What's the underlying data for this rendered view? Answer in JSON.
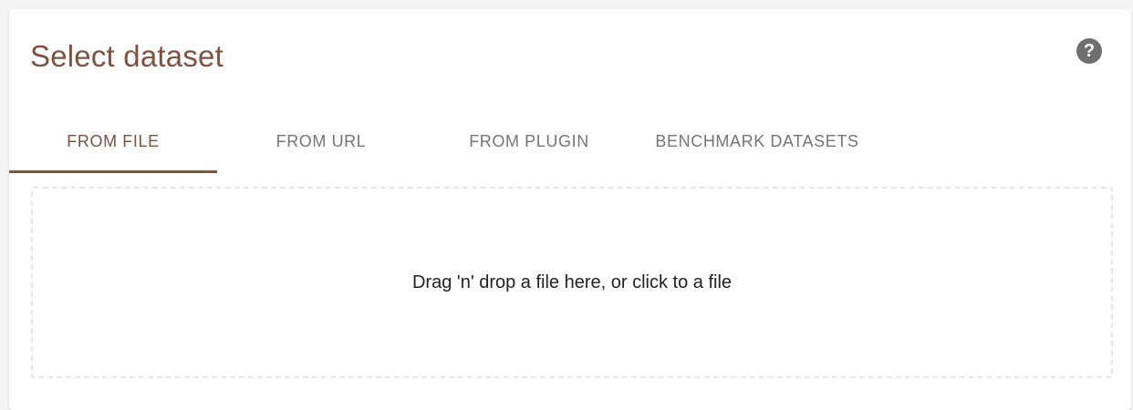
{
  "title": "Select dataset",
  "help_icon": {
    "icon": "help-circle-icon",
    "glyph": "?"
  },
  "tabs": [
    {
      "label": "FROM FILE",
      "active": true
    },
    {
      "label": "FROM URL",
      "active": false
    },
    {
      "label": "FROM PLUGIN",
      "active": false
    },
    {
      "label": "BENCHMARK DATASETS",
      "active": false
    }
  ],
  "dropzone": {
    "text": "Drag 'n' drop a file here, or click to a file"
  },
  "colors": {
    "accent": "#7b5342",
    "tab_inactive": "#757575",
    "help_icon_bg": "#6f6f6f",
    "dropzone_border": "#e6e6e6"
  }
}
